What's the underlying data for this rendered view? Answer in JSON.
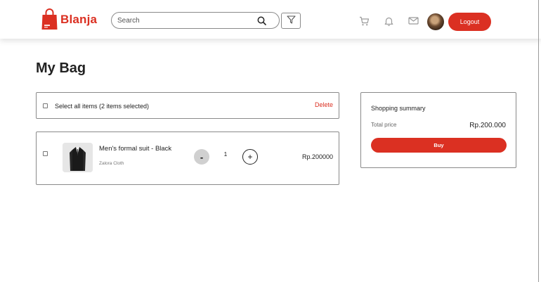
{
  "header": {
    "brand": "Blanja",
    "search": {
      "placeholder": "Search",
      "value": ""
    },
    "icons": [
      "shopping-bag-logo-icon",
      "search-icon",
      "filter-icon",
      "cart-icon",
      "bell-icon",
      "mail-icon"
    ],
    "logout_label": "Logout"
  },
  "main": {
    "title": "My Bag",
    "select_all_label": "Select all items (2 items selected)",
    "delete_label": "Delete",
    "items": [
      {
        "name": "Men's formal suit - Black",
        "store": "Zalora Cloth",
        "minus_label": "-",
        "quantity": "1",
        "plus_label": "+",
        "price": "Rp.200000"
      }
    ]
  },
  "summary": {
    "title": "Shopping summary",
    "total_label": "Total price",
    "total_value": "Rp.200.000",
    "buy_label": "Buy"
  },
  "colors": {
    "accent": "#DB3022",
    "border": "#8a8a8a"
  }
}
